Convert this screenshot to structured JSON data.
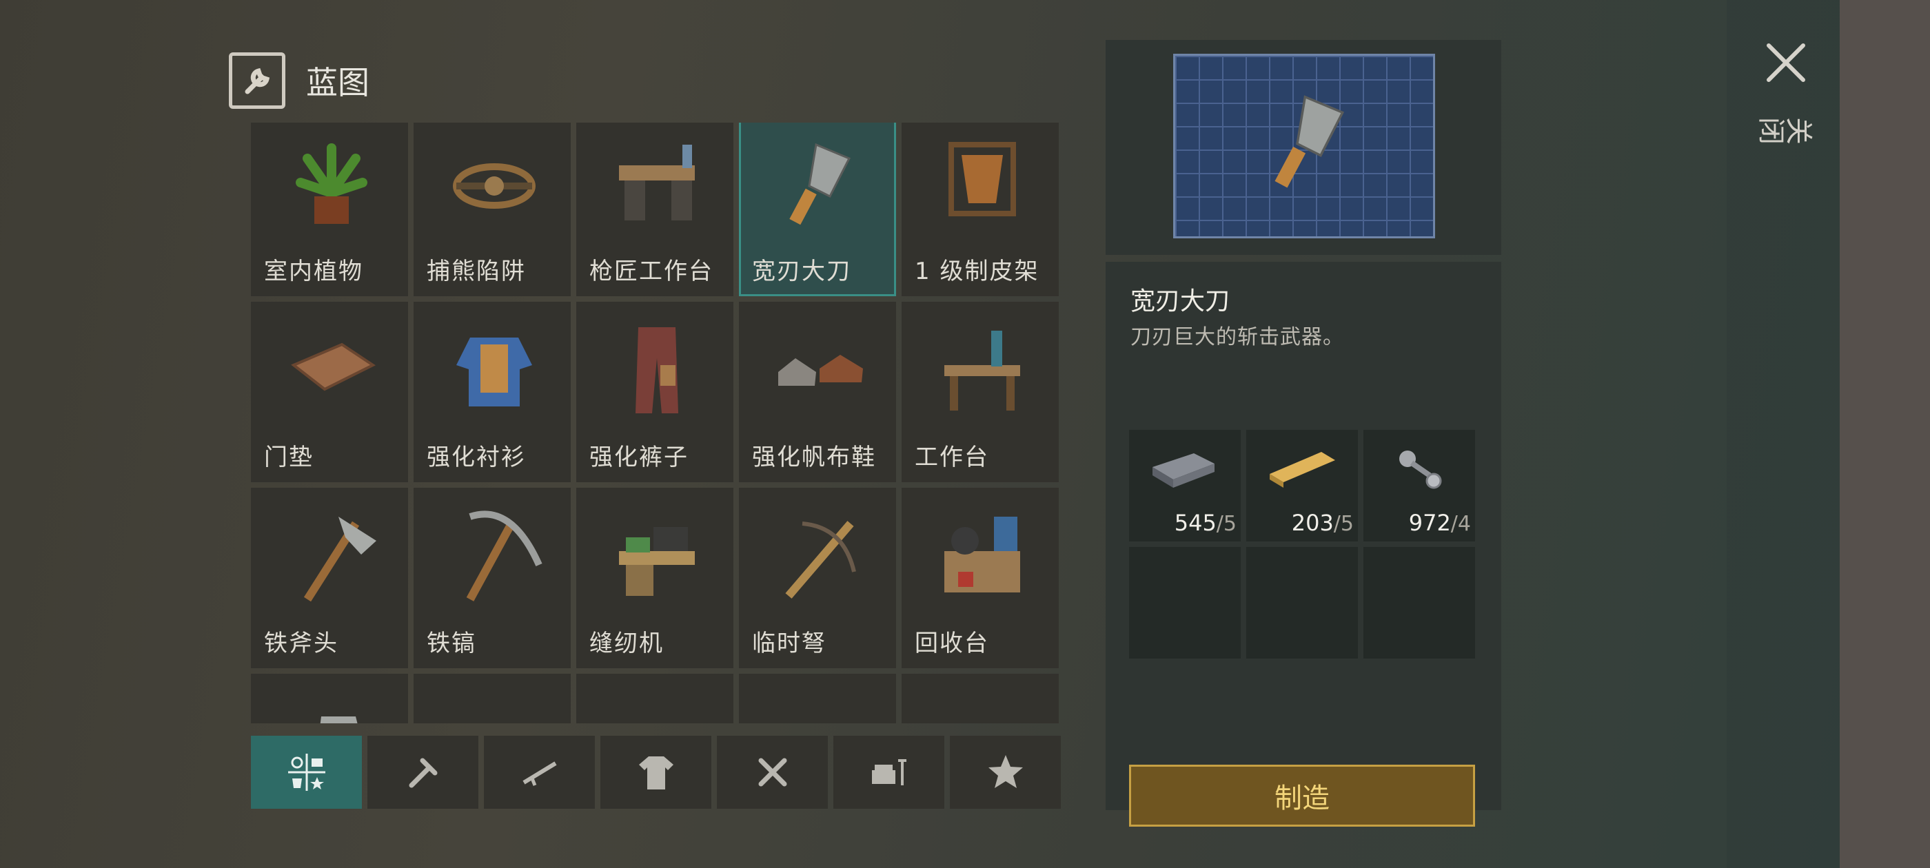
{
  "header": {
    "title": "蓝图",
    "icon": "blueprint-wrench-icon"
  },
  "items": [
    {
      "label": "室内植物",
      "icon": "potted-plant-icon"
    },
    {
      "label": "捕熊陷阱",
      "icon": "bear-trap-icon"
    },
    {
      "label": "枪匠工作台",
      "icon": "gunsmith-bench-icon"
    },
    {
      "label": "宽刃大刀",
      "icon": "cleaver-icon"
    },
    {
      "label": "1 级制皮架",
      "icon": "tanning-rack-icon"
    },
    {
      "label": "门垫",
      "icon": "doormat-icon"
    },
    {
      "label": "强化衬衫",
      "icon": "armored-shirt-icon"
    },
    {
      "label": "强化裤子",
      "icon": "armored-pants-icon"
    },
    {
      "label": "强化帆布鞋",
      "icon": "armored-sneakers-icon"
    },
    {
      "label": "工作台",
      "icon": "workbench-icon"
    },
    {
      "label": "铁斧头",
      "icon": "iron-axe-icon"
    },
    {
      "label": "铁镐",
      "icon": "iron-pickaxe-icon"
    },
    {
      "label": "缝纫机",
      "icon": "sewing-machine-icon"
    },
    {
      "label": "临时弩",
      "icon": "crossbow-icon"
    },
    {
      "label": "回收台",
      "icon": "recycler-icon"
    },
    {
      "label": "",
      "icon": "shovel-icon"
    },
    {
      "label": "",
      "icon": "beanie-icon"
    },
    {
      "label": "",
      "icon": "jacket-icon"
    },
    {
      "label": "",
      "icon": "jeans-icon"
    },
    {
      "label": "",
      "icon": "boots-icon"
    }
  ],
  "tabs": [
    {
      "icon": "all-categories-icon",
      "active": true
    },
    {
      "icon": "tools-icon",
      "active": false
    },
    {
      "icon": "weapons-icon",
      "active": false
    },
    {
      "icon": "clothing-icon",
      "active": false
    },
    {
      "icon": "crafting-icon",
      "active": false
    },
    {
      "icon": "furniture-icon",
      "active": false
    },
    {
      "icon": "favorites-icon",
      "active": false
    }
  ],
  "detail": {
    "name": "宽刃大刀",
    "description": "刀刃巨大的斩击武器。",
    "materials": [
      {
        "icon": "iron-ingot-icon",
        "have": "545",
        "need": "/5"
      },
      {
        "icon": "wooden-plank-icon",
        "have": "203",
        "need": "/5"
      },
      {
        "icon": "bolts-nuts-icon",
        "have": "972",
        "need": "/4"
      }
    ],
    "craft_label": "制造"
  },
  "close_label": "关闭",
  "colors": {
    "accent": "#2e6b66",
    "craft": "#6f5520",
    "craft_border": "#c6a043"
  }
}
